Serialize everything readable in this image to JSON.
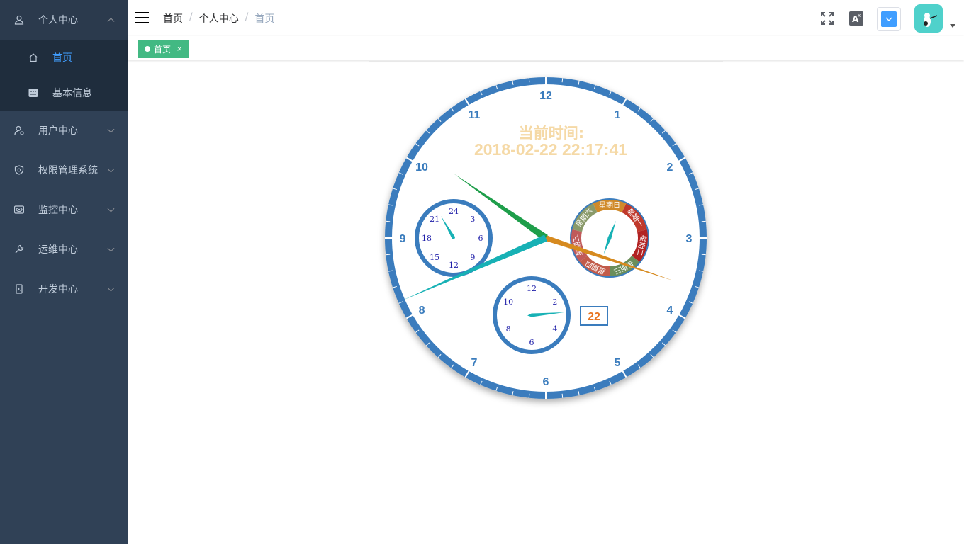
{
  "sidebar": {
    "menus": [
      {
        "label": "个人中心",
        "icon": "user-icon",
        "open": true
      },
      {
        "label": "用户中心",
        "icon": "user-manage-icon"
      },
      {
        "label": "权限管理系统",
        "icon": "shield-icon"
      },
      {
        "label": "监控中心",
        "icon": "eye-icon"
      },
      {
        "label": "运维中心",
        "icon": "wrench-icon"
      },
      {
        "label": "开发中心",
        "icon": "code-icon"
      }
    ],
    "submenu": [
      {
        "label": "首页",
        "icon": "home-icon",
        "active": true
      },
      {
        "label": "基本信息",
        "icon": "keyboard-icon"
      }
    ]
  },
  "breadcrumb": [
    "首页",
    "个人中心",
    "首页"
  ],
  "tab": {
    "label": "首页",
    "close": "×"
  },
  "clock": {
    "caption_line1": "当前时间:",
    "caption_line2": "2018-02-22 22:17:41",
    "hours": [
      "12",
      "1",
      "2",
      "3",
      "4",
      "5",
      "6",
      "7",
      "8",
      "9",
      "10",
      "11"
    ],
    "sub24": [
      "24",
      "3",
      "6",
      "9",
      "12",
      "15",
      "18",
      "21"
    ],
    "sub12": [
      "12",
      "2",
      "4",
      "6",
      "8",
      "10"
    ],
    "weekdays": [
      "星期日",
      "星期一",
      "星期二",
      "星期三",
      "星期四",
      "星期五",
      "星期六"
    ],
    "date_box": "22"
  },
  "colors": {
    "sidebar_bg": "#304156",
    "active": "#409eff",
    "tag": "#42b983",
    "clock_ring": "#3a7cbd",
    "caption": "#f5d9a6"
  }
}
